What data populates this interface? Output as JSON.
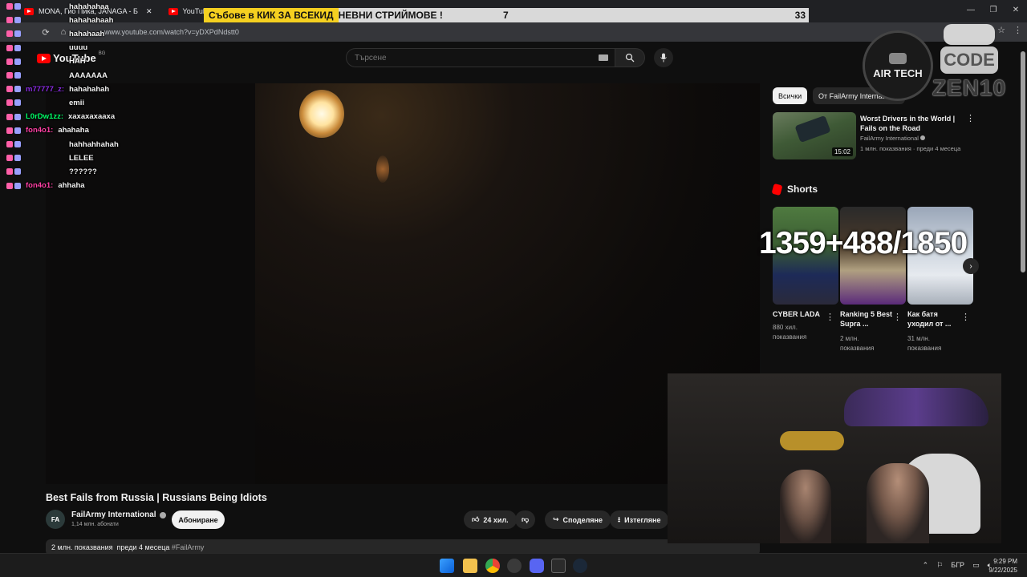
{
  "browser": {
    "tabs": [
      {
        "label": "MONA, Гио Пика, JANAGA - Б",
        "active": false
      },
      {
        "label": "YouTube",
        "active": true
      }
    ],
    "url": "www.youtube.com/watch?v=yDXPdNdstt0"
  },
  "stream_bar": {
    "highlight": "Събове в КИК ЗА ВСЕКИД",
    "rest": "НЕВНИ СТРИЙМОВЕ !",
    "left_number": "7",
    "right_number": "33"
  },
  "youtube": {
    "logo": "YouTube",
    "logo_region": "BG",
    "search_placeholder": "Търсене"
  },
  "video": {
    "title": "Best Fails from Russia | Russians Being Idiots",
    "channel": "FailArmy International",
    "channel_avatar": "FA",
    "subscribers": "1,14 млн. абонати",
    "subscribe_label": "Абониране",
    "likes": "24 хил.",
    "share_label": "Споделяне",
    "download_label": "Изтегляне",
    "views": "2 млн. показвания",
    "published": "преди 4 месеца",
    "hashtag": "#FailArmy"
  },
  "filters": {
    "chips": [
      "Всички",
      "От FailArmy International"
    ]
  },
  "recommendation": {
    "title": "Worst Drivers in the World | Fails on the Road",
    "channel": "FailArmy International",
    "meta": "1 млн. показвания · преди 4 месеца",
    "duration": "15:02"
  },
  "shorts": {
    "heading": "Shorts",
    "items": [
      {
        "title": "CYBER LADA",
        "views_1": "880 хил.",
        "views_2": "показвания"
      },
      {
        "title": "Ranking 5 Best Supra ...",
        "views_1": "2 млн.",
        "views_2": "показвания"
      },
      {
        "title": "Как батя уходил от ...",
        "views_1": "31 млн.",
        "views_2": "показвания"
      }
    ]
  },
  "overlay": {
    "counter": "1359+488/1850",
    "sponsor_name": "AIR TECH",
    "code_label": "CODE",
    "code_value": "ZEN10"
  },
  "chat": [
    {
      "user": "",
      "msg": "hahahahaa",
      "color": "#1e6fff"
    },
    {
      "user": "",
      "msg": "hahahahaah",
      "color": "#1e6fff"
    },
    {
      "user": "",
      "msg": "hahahaah",
      "color": "#1e6fff"
    },
    {
      "user": "",
      "msg": "uuuu",
      "color": "#1e6fff"
    },
    {
      "user": "",
      "msg": "HAH",
      "color": "#1e6fff"
    },
    {
      "user": "",
      "msg": "AAAAAAA",
      "color": "#1e6fff"
    },
    {
      "user": "m77777_z:",
      "msg": "hahahahah",
      "color": "#8a2be2"
    },
    {
      "user": "",
      "msg": "emii",
      "color": "#1e6fff"
    },
    {
      "user": "L0rDw1zz:",
      "msg": "xaxaxaxaaxa",
      "color": "#00ff66"
    },
    {
      "user": "fon4o1:",
      "msg": "ahahaha",
      "color": "#ff3fa4"
    },
    {
      "user": "",
      "msg": "hahhahhahah",
      "color": "#1e3fff"
    },
    {
      "user": "",
      "msg": "LELEE",
      "color": "#1e6fff"
    },
    {
      "user": "",
      "msg": "??????",
      "color": "#1e6fff"
    },
    {
      "user": "fon4o1:",
      "msg": "ahhaha",
      "color": "#ff3fa4"
    }
  ],
  "taskbar": {
    "language": "БГР",
    "time": "9:29 PM",
    "date": "9/22/2025"
  }
}
